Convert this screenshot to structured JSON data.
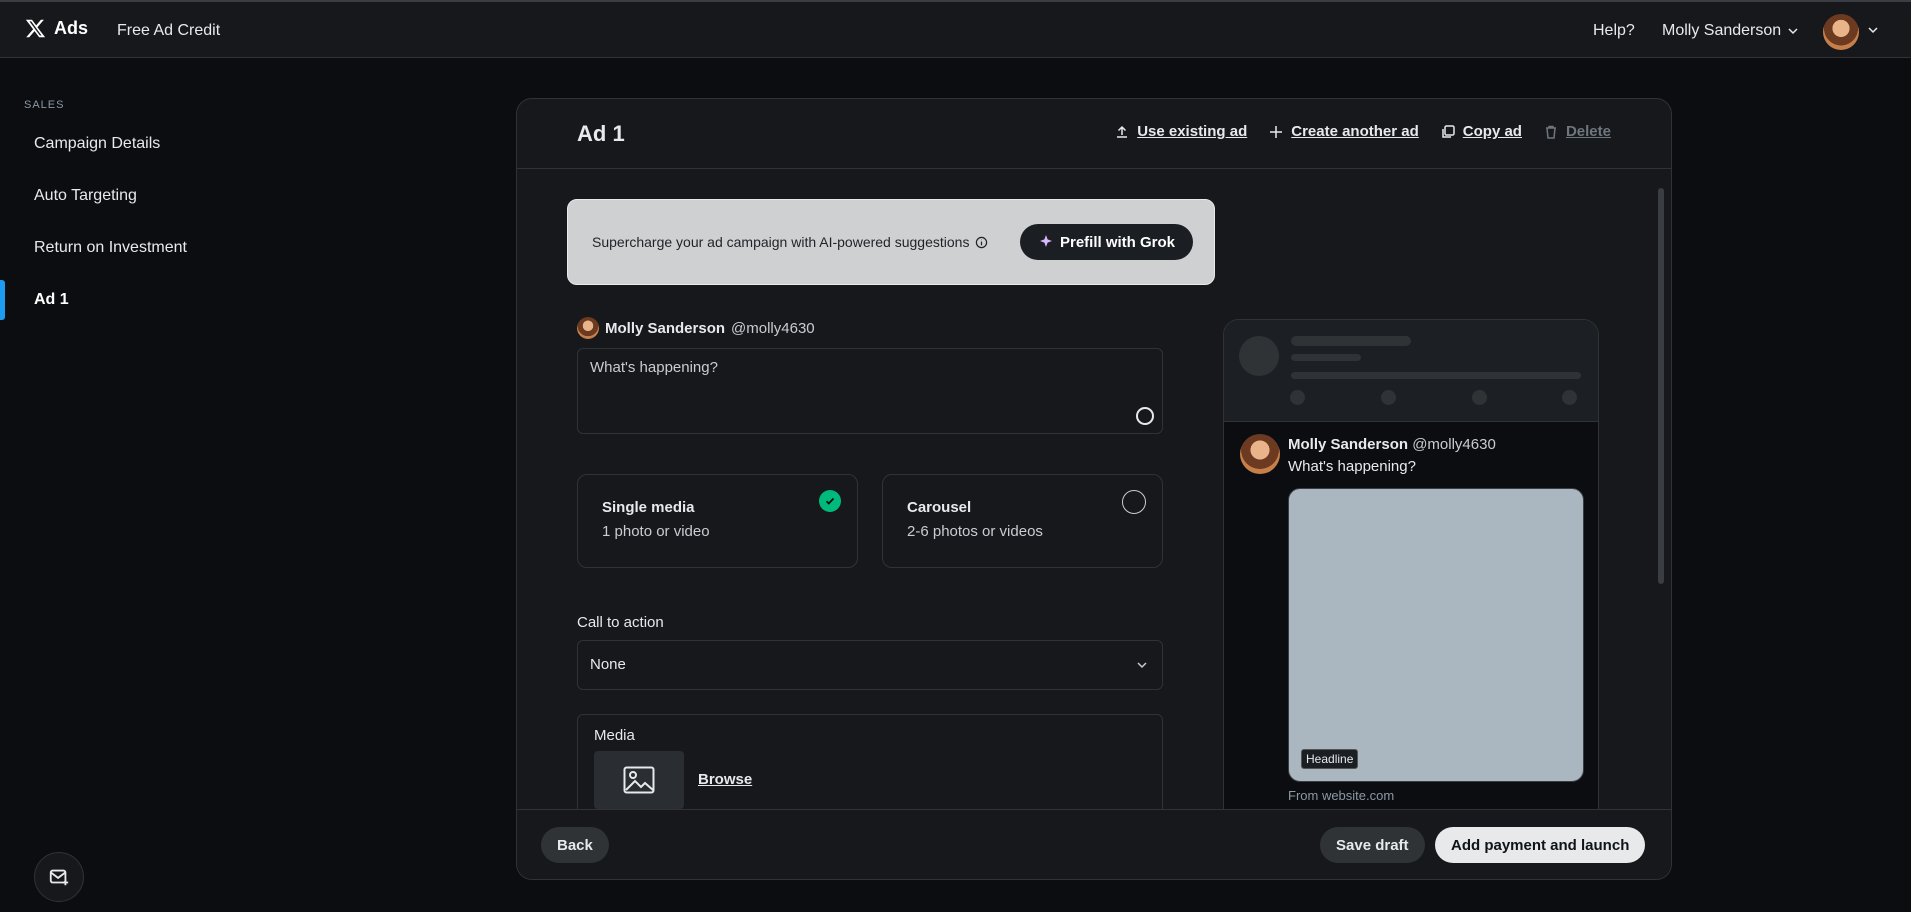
{
  "topbar": {
    "logo_text": "Ads",
    "free_credit": "Free Ad Credit",
    "help": "Help?",
    "user_name": "Molly Sanderson"
  },
  "sidebar": {
    "section": "SALES",
    "items": [
      {
        "label": "Campaign Details",
        "active": false
      },
      {
        "label": "Auto Targeting",
        "active": false
      },
      {
        "label": "Return on Investment",
        "active": false
      },
      {
        "label": "Ad 1",
        "active": true
      }
    ]
  },
  "card": {
    "title": "Ad 1",
    "actions": {
      "use_existing": "Use existing ad",
      "create_another": "Create another ad",
      "copy": "Copy ad",
      "delete": "Delete"
    }
  },
  "grok": {
    "text": "Supercharge your ad campaign with AI-powered suggestions",
    "button": "Prefill with Grok"
  },
  "author": {
    "name": "Molly Sanderson",
    "handle": "@molly4630"
  },
  "compose": {
    "placeholder": "What's happening?"
  },
  "media_options": {
    "single": {
      "title": "Single media",
      "sub": "1 photo or video",
      "selected": true
    },
    "carousel": {
      "title": "Carousel",
      "sub": "2-6 photos or videos",
      "selected": false
    }
  },
  "cta": {
    "label": "Call to action",
    "value": "None"
  },
  "media": {
    "label": "Media",
    "browse": "Browse"
  },
  "preview": {
    "name": "Molly Sanderson",
    "handle": "@molly4630",
    "text": "What's happening?",
    "headline": "Headline",
    "from": "From website.com"
  },
  "footer": {
    "back": "Back",
    "save_draft": "Save draft",
    "launch": "Add payment and launch"
  },
  "colors": {
    "accent": "#1d9bf0",
    "success": "#00ba7c"
  }
}
